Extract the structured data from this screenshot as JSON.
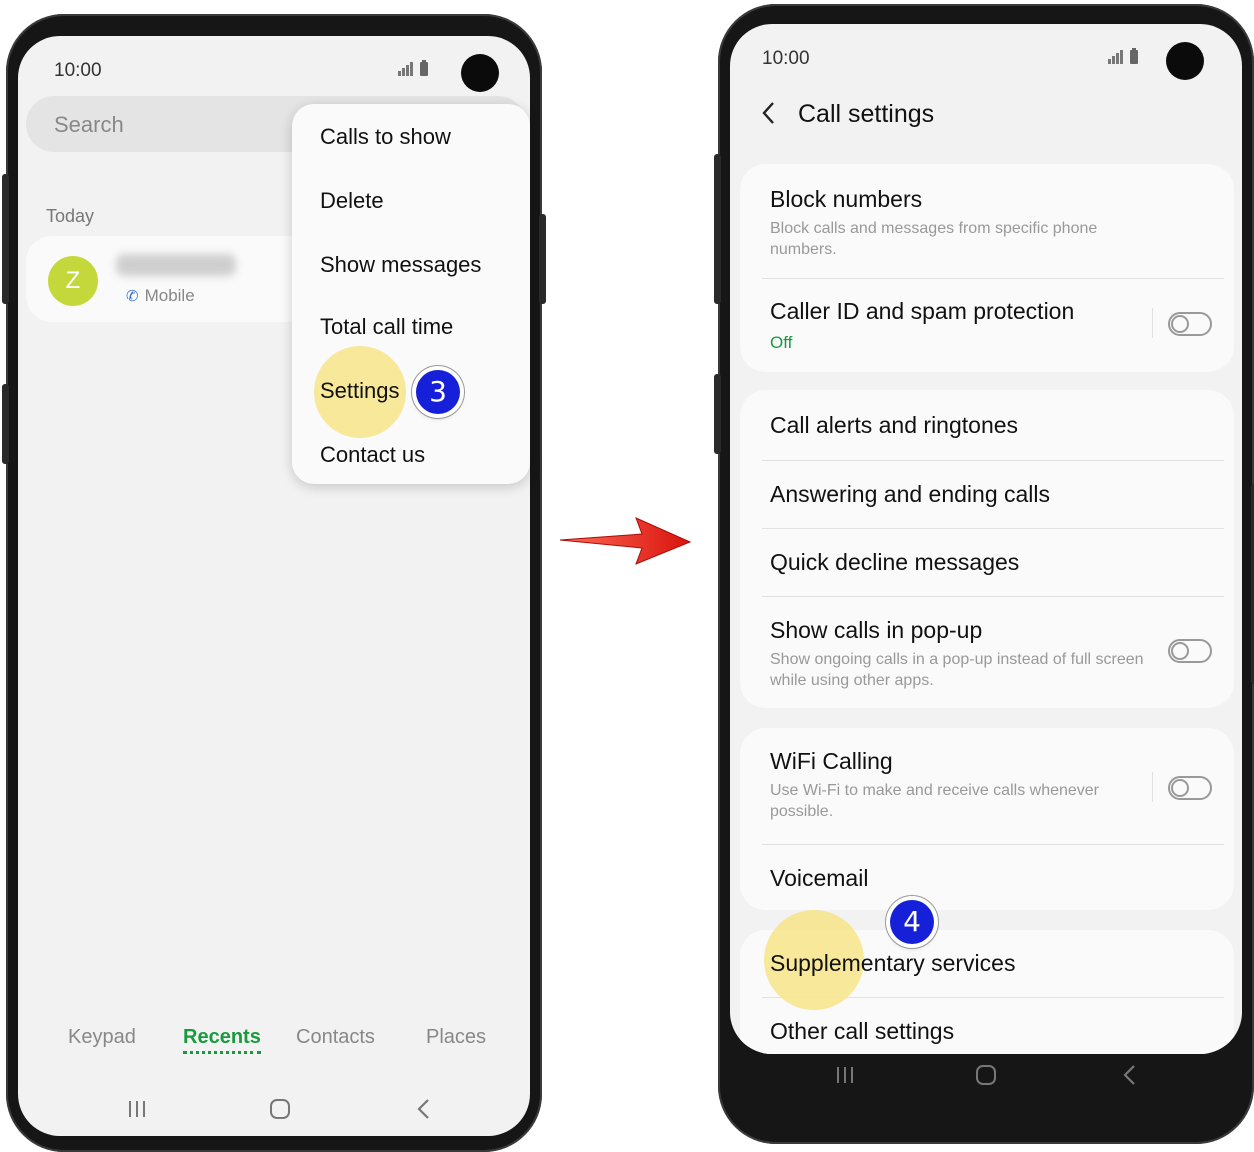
{
  "left_screen": {
    "status_time": "10:00",
    "search_placeholder": "Search",
    "section_today": "Today",
    "call_entry": {
      "avatar_letter": "Z",
      "type_label": "Mobile"
    },
    "menu_items": [
      "Calls to show",
      "Delete",
      "Show messages",
      "Total call time",
      "Settings",
      "Contact us"
    ],
    "step_badge": "3",
    "tabs": [
      {
        "label": "Keypad",
        "active": false
      },
      {
        "label": "Recents",
        "active": true
      },
      {
        "label": "Contacts",
        "active": false
      },
      {
        "label": "Places",
        "active": false
      }
    ],
    "nav_icons": [
      "recent-apps-icon",
      "home-icon",
      "back-icon"
    ]
  },
  "right_screen": {
    "status_time": "10:00",
    "header_title": "Call settings",
    "step_badge": "4",
    "groups": [
      {
        "items": [
          {
            "title": "Block numbers",
            "subtitle": "Block calls and messages from specific phone numbers."
          },
          {
            "title": "Caller ID and spam protection",
            "subtitle": "Off",
            "toggle": false
          }
        ]
      },
      {
        "items": [
          {
            "title": "Call alerts and ringtones"
          },
          {
            "title": "Answering and ending calls"
          },
          {
            "title": "Quick decline messages"
          },
          {
            "title": "Show calls in pop-up",
            "subtitle": "Show ongoing calls in a pop-up instead of full screen while using other apps.",
            "toggle": false
          }
        ]
      },
      {
        "items": [
          {
            "title": "WiFi Calling",
            "subtitle": "Use Wi-Fi to make and receive calls whenever possible.",
            "toggle": false
          },
          {
            "title": "Voicemail"
          }
        ]
      },
      {
        "items": [
          {
            "title": "Supplementary services"
          },
          {
            "title": "Other call settings"
          }
        ]
      }
    ]
  },
  "colors": {
    "accent_green": "#1a9a3f",
    "badge_blue": "#1520d8",
    "highlight_yellow": "#f7e27a",
    "arrow_red": "#e8231a",
    "avatar_color": "#c5d83b"
  }
}
